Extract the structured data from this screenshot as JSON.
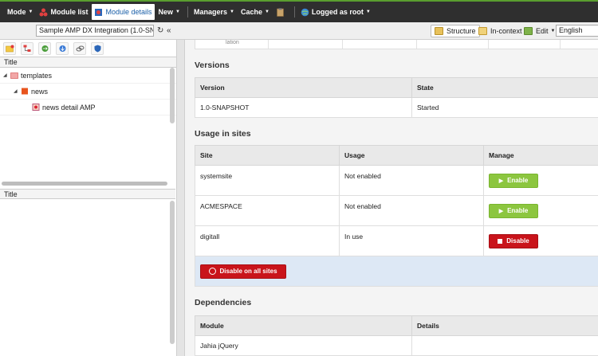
{
  "topbar": {
    "mode": "Mode",
    "module_list": "Module list",
    "module_details": "Module details",
    "new": "New",
    "managers": "Managers",
    "cache": "Cache",
    "logged_as": "Logged as root"
  },
  "toolbar": {
    "site_select": "Sample AMP DX Integration (1.0-SN",
    "refresh_icon": "refresh-icon",
    "collapse_icon": "double-left-arrow-icon",
    "structure": "Structure",
    "in_context": "In-context",
    "edit": "Edit",
    "language": "English"
  },
  "left": {
    "tree_header": "Title",
    "tree": [
      {
        "label": "templates",
        "level": 0
      },
      {
        "label": "news",
        "level": 1
      },
      {
        "label": "news detail AMP",
        "level": 2
      }
    ],
    "lower_header": "Title"
  },
  "main": {
    "stub_text": "lation",
    "versions": {
      "title": "Versions",
      "headers": [
        "Version",
        "State"
      ],
      "rows": [
        [
          "1.0-SNAPSHOT",
          "Started"
        ]
      ]
    },
    "usage": {
      "title": "Usage in sites",
      "headers": [
        "Site",
        "Usage",
        "Manage"
      ],
      "rows": [
        {
          "site": "systemsite",
          "usage": "Not enabled",
          "action": "Enable"
        },
        {
          "site": "ACMESPACE",
          "usage": "Not enabled",
          "action": "Enable"
        },
        {
          "site": "digitall",
          "usage": "In use",
          "action": "Disable"
        }
      ],
      "disable_all": "Disable on all sites"
    },
    "dependencies": {
      "title": "Dependencies",
      "headers": [
        "Module",
        "Details"
      ],
      "rows": [
        [
          "Jahia jQuery",
          ""
        ]
      ]
    }
  },
  "colors": {
    "enable": "#8cc63f",
    "disable": "#c9141b",
    "topbar": "#2f2f2f",
    "active_tab_text": "#1a5fa8"
  }
}
